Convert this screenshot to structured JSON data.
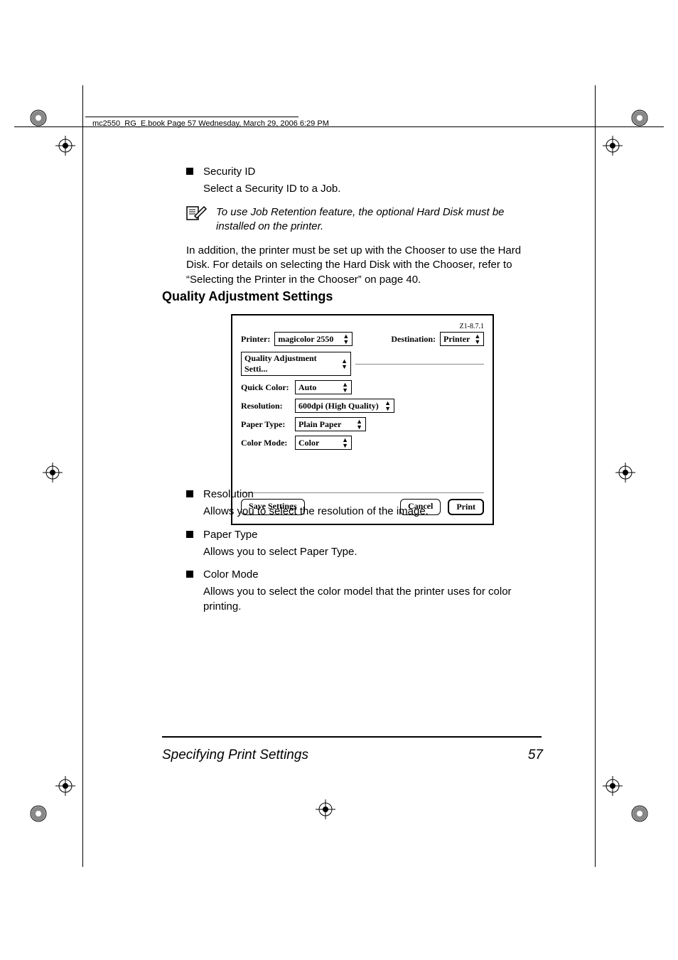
{
  "header_line": "mc2550_RG_E.book  Page 57  Wednesday, March 29, 2006  6:29 PM",
  "section1": {
    "bullet_title": "Security ID",
    "bullet_desc": "Select a Security ID to a Job.",
    "note": "To use Job Retention feature, the optional Hard Disk must be installed on the printer.",
    "para": "In addition, the printer must be set up with the Chooser to use the Hard Disk. For details on selecting the Hard Disk with the Chooser, refer to “Selecting the Printer in the Chooser” on page 40."
  },
  "heading": "Quality Adjustment Settings",
  "dialog": {
    "version": "Z1-8.7.1",
    "printer_label": "Printer:",
    "printer_value": "magicolor 2550",
    "destination_label": "Destination:",
    "destination_value": "Printer",
    "tab_value": "Quality Adjustment Setti...",
    "fields": [
      {
        "label": "Quick Color:",
        "value": "Auto"
      },
      {
        "label": "Resolution:",
        "value": "600dpi (High Quality)"
      },
      {
        "label": "Paper Type:",
        "value": "Plain Paper"
      },
      {
        "label": "Color Mode:",
        "value": "Color"
      }
    ],
    "save_btn": "Save Settings",
    "cancel_btn": "Cancel",
    "print_btn": "Print"
  },
  "bullets": [
    {
      "title": "Resolution",
      "desc": "Allows you to select the resolution of the image."
    },
    {
      "title": "Paper Type",
      "desc": "Allows you to select Paper Type."
    },
    {
      "title": "Color Mode",
      "desc": "Allows you to select the color model that the printer uses for color printing."
    }
  ],
  "footer": {
    "left": "Specifying Print Settings",
    "right": "57"
  }
}
